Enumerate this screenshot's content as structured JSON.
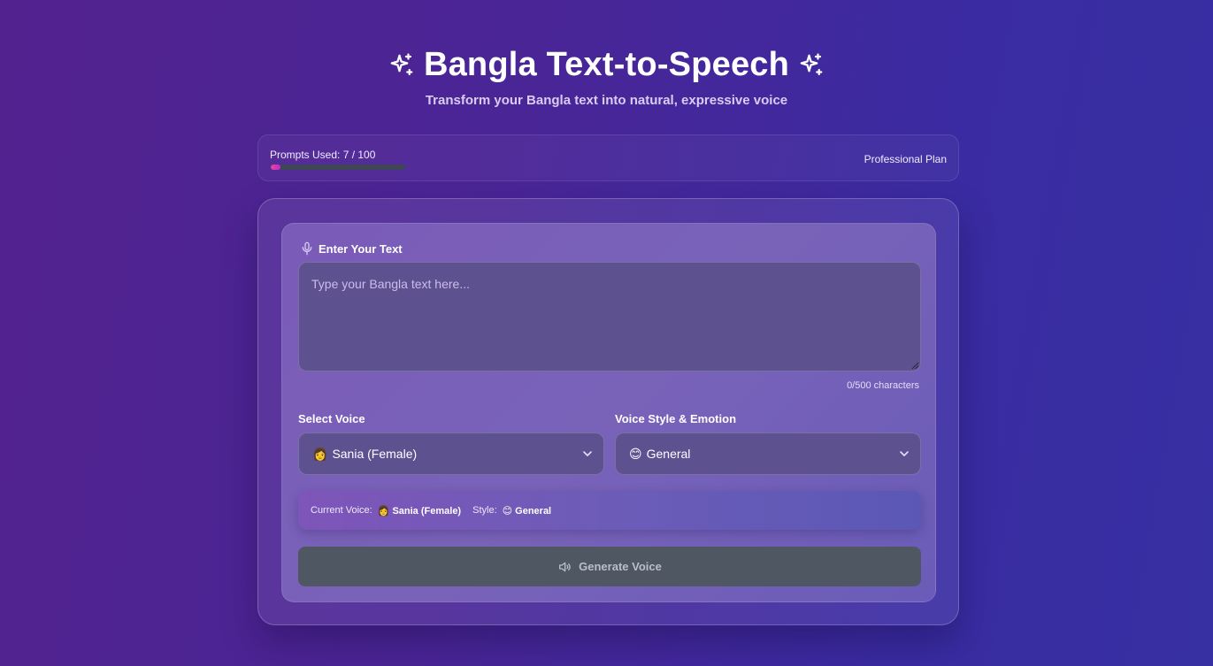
{
  "header": {
    "title": "Bangla Text-to-Speech",
    "subtitle": "Transform your Bangla text into natural, expressive voice"
  },
  "usage": {
    "label": "Prompts Used: 7 / 100",
    "used": 7,
    "total": 100,
    "fraction": 0.07,
    "plan": "Professional Plan"
  },
  "form": {
    "text_label": "Enter Your Text",
    "text_value": "",
    "text_placeholder": "Type your Bangla text here...",
    "char_count": "0/500 characters",
    "voice_label": "Select Voice",
    "voice_selected_emoji": "👩",
    "voice_selected": "Sania (Female)",
    "style_label": "Voice Style & Emotion",
    "style_selected_emoji": "😊",
    "style_selected": "General"
  },
  "current": {
    "voice_label": "Current Voice:",
    "voice_value": "👩 Sania (Female)",
    "style_label": "Style:",
    "style_value": "😊 General"
  },
  "actions": {
    "generate_label": "Generate Voice"
  },
  "icons": {
    "sparkle": "sparkle-icon",
    "mic": "mic-icon",
    "chevron": "chevron-down-icon",
    "speaker": "speaker-icon"
  },
  "colors": {
    "accent_progress": "#ec4899",
    "button_bg": "#4f5763"
  }
}
